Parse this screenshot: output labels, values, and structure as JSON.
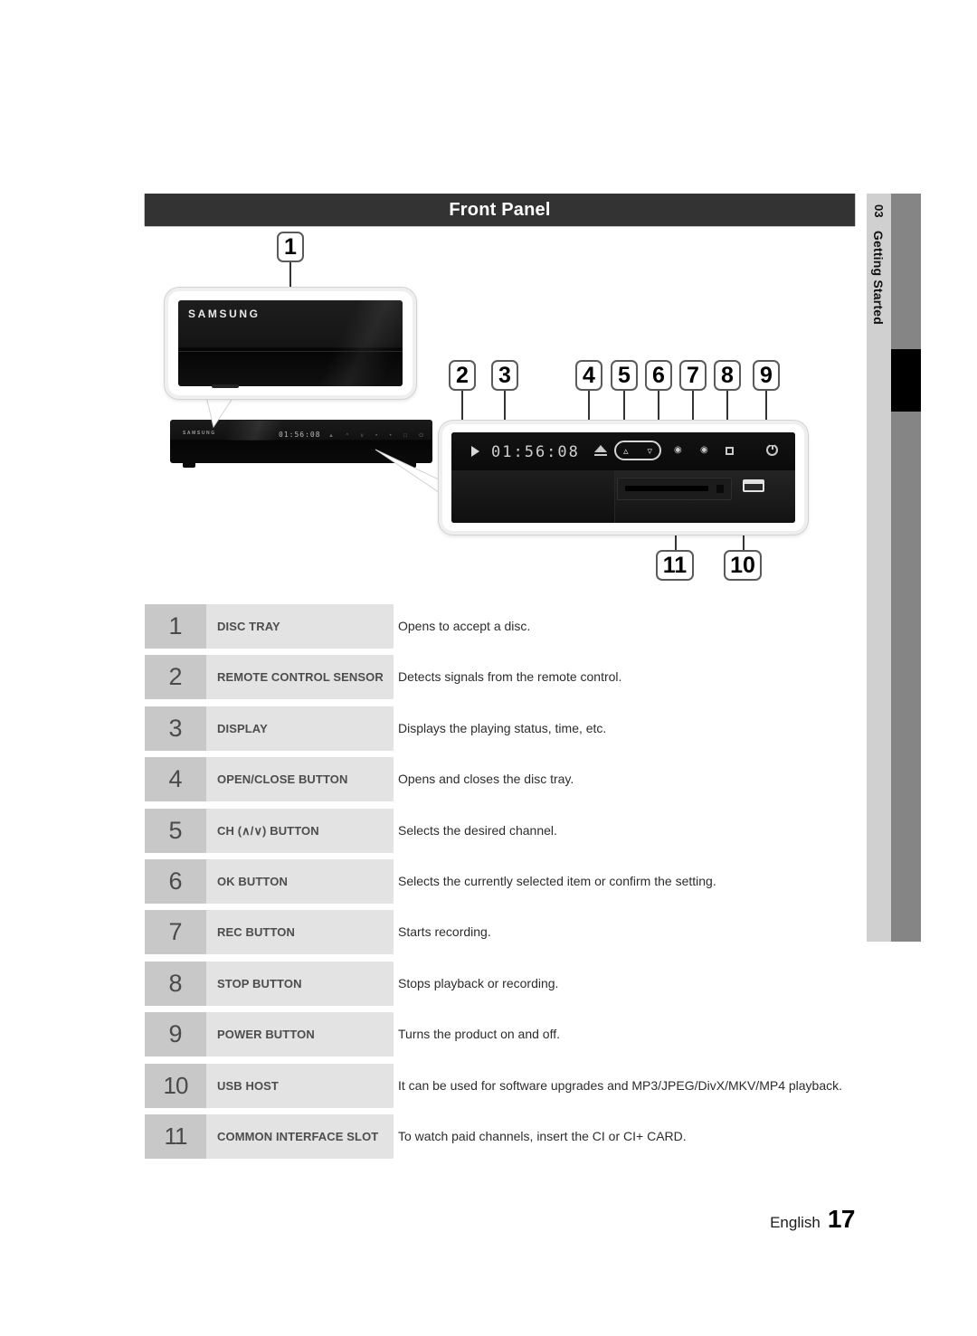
{
  "section": {
    "header_title": "Front Panel"
  },
  "chapter_tab": {
    "number": "03",
    "label": "Getting Started"
  },
  "device": {
    "brand": "SAMSUNG",
    "display_time": "01:56:08",
    "play_icon": "play-triangle-icon",
    "panel_icons": [
      "eject-icon",
      "channel-up-icon",
      "channel-down-icon",
      "rec-icon",
      "rec-icon",
      "stop-icon",
      "power-icon"
    ],
    "ci_slot_name": "common-interface-slot",
    "usb_port_name": "usb-host-port"
  },
  "callouts": [
    {
      "n": "1"
    },
    {
      "n": "2"
    },
    {
      "n": "3"
    },
    {
      "n": "4"
    },
    {
      "n": "5"
    },
    {
      "n": "6"
    },
    {
      "n": "7"
    },
    {
      "n": "8"
    },
    {
      "n": "9"
    },
    {
      "n": "10"
    },
    {
      "n": "11"
    }
  ],
  "spec_table": {
    "rows": [
      {
        "num": "1",
        "label": "DISC TRAY",
        "desc": "Opens to accept a disc."
      },
      {
        "num": "2",
        "label": "REMOTE CONTROL SENSOR",
        "desc": "Detects signals from the remote control."
      },
      {
        "num": "3",
        "label": "DISPLAY",
        "desc": "Displays the playing status, time, etc."
      },
      {
        "num": "4",
        "label": "OPEN/CLOSE BUTTON",
        "desc": "Opens and closes the disc tray."
      },
      {
        "num": "5",
        "label": "CH (∧/∨) BUTTON",
        "desc": "Selects the desired channel."
      },
      {
        "num": "6",
        "label": "OK BUTTON",
        "desc": "Selects the currently selected item or confirm the setting."
      },
      {
        "num": "7",
        "label": "REC BUTTON",
        "desc": "Starts recording."
      },
      {
        "num": "8",
        "label": "STOP BUTTON",
        "desc": "Stops playback or recording."
      },
      {
        "num": "9",
        "label": "POWER BUTTON",
        "desc": "Turns the product on and off."
      },
      {
        "num": "10",
        "label": "USB HOST",
        "desc": "It can be used for software upgrades and MP3/JPEG/DivX/MKV/MP4 playback."
      },
      {
        "num": "11",
        "label": "COMMON INTERFACE SLOT",
        "desc": "To watch paid channels, insert the CI or CI+ CARD."
      }
    ]
  },
  "footer": {
    "language": "English",
    "page_number": "17"
  },
  "colors": {
    "header_bg": "#333333",
    "tab_light": "#d0d0d0",
    "tab_dark": "#858585",
    "tab_marker": "#000000",
    "num_cell": "#c8c8c8",
    "label_cell": "#e3e3e3"
  }
}
